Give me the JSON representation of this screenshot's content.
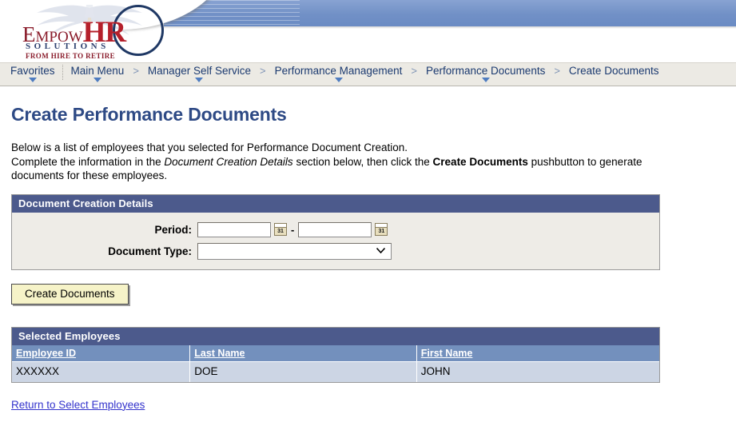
{
  "header": {
    "logo": {
      "empow": "Empow",
      "hr": "HR",
      "solutions": "SOLUTIONS",
      "tagline": "FROM HIRE TO RETIRE"
    },
    "banner_color": "#7191c8"
  },
  "breadcrumb": {
    "items": [
      {
        "label": "Favorites",
        "has_dropdown": true,
        "separator": ""
      },
      {
        "label": "Main Menu",
        "has_dropdown": true,
        "separator": ">"
      },
      {
        "label": "Manager Self Service",
        "has_dropdown": true,
        "separator": ">"
      },
      {
        "label": "Performance Management",
        "has_dropdown": true,
        "separator": ">"
      },
      {
        "label": "Performance Documents",
        "has_dropdown": true,
        "separator": ">"
      },
      {
        "label": "Create Documents",
        "has_dropdown": false,
        "separator": ">"
      }
    ]
  },
  "main": {
    "title": "Create Performance Documents",
    "intro_line1": "Below is a list of employees that you selected for Performance Document Creation.",
    "intro_line2_a": "Complete the information in the ",
    "intro_line2_em": "Document Creation Details",
    "intro_line2_b": " section below, then click the ",
    "intro_line2_strong": "Create Documents",
    "intro_line2_c": " pushbutton to generate documents for these employees.",
    "details": {
      "section_title": "Document Creation Details",
      "period_label": "Period:",
      "period_from_value": "",
      "period_from_placeholder": "",
      "period_separator": "-",
      "period_to_value": "",
      "period_to_placeholder": "",
      "calendar_icon_label": "31",
      "document_type_label": "Document Type:",
      "document_type_value": "",
      "document_type_options": [
        ""
      ]
    },
    "create_button_label": "Create Documents",
    "employees": {
      "section_title": "Selected Employees",
      "columns": [
        "Employee ID",
        "Last Name",
        "First Name"
      ],
      "rows": [
        {
          "employee_id": "XXXXXX",
          "last_name": "DOE",
          "first_name": "JOHN"
        }
      ]
    },
    "return_link_label": "Return to Select Employees"
  }
}
